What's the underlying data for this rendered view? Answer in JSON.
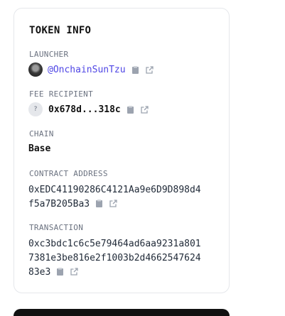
{
  "card": {
    "title": "TOKEN INFO",
    "launcher": {
      "label": "LAUNCHER",
      "handle": "@OnchainSunTzu"
    },
    "fee_recipient": {
      "label": "FEE RECIPIENT",
      "avatar_glyph": "?",
      "address": "0x678d...318c"
    },
    "chain": {
      "label": "CHAIN",
      "value": "Base"
    },
    "contract": {
      "label": "CONTRACT ADDRESS",
      "line1": "0xEDC41190286C4121Aa9e6D9D898d4",
      "line2": "f5a7B205Ba3"
    },
    "transaction": {
      "label": "TRANSACTION",
      "line1": "0xc3bdc1c6c5e79464ad6aa9231a801",
      "line2": "7381e3be816e2f1003b2d4662547624",
      "line3": "83e3"
    }
  },
  "icons": {
    "copy": "clipboard-icon",
    "open": "external-link-icon"
  },
  "colors": {
    "accent": "#4f46e5",
    "muted": "#6b7280",
    "icon": "#9ca3af"
  }
}
